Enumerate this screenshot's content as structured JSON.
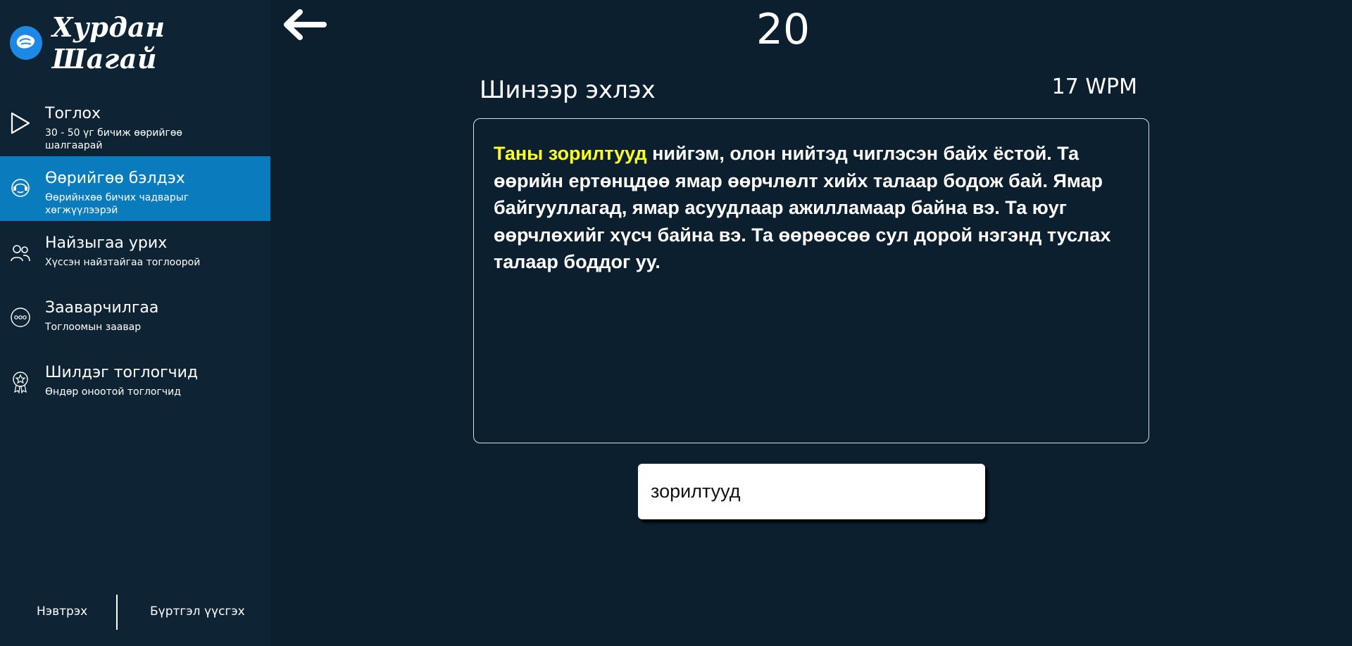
{
  "brand": {
    "name": "Хурдан Шагай",
    "logo_icon": "shagai-logo-icon"
  },
  "nav": {
    "items": [
      {
        "title": "Тоглох",
        "subtitle": "30 - 50 үг бичиж өөрийгөө шалгаарай",
        "icon": "play-icon",
        "active": false
      },
      {
        "title": "Өөрийгөө бэлдэх",
        "subtitle": "Өөрийнхөө бичих чадварыг хөгжүүлээрэй",
        "icon": "practice-icon",
        "active": true
      },
      {
        "title": "Найзыгаа урих",
        "subtitle": "Хүссэн найзтайгаа тоглоорой",
        "icon": "friends-icon",
        "active": false
      },
      {
        "title": "Зааварчилгаа",
        "subtitle": "Тоглоомын заавар",
        "icon": "instructions-icon",
        "active": false
      },
      {
        "title": "Шилдэг тоглогчид",
        "subtitle": "Өндөр оноотой тоглогчид",
        "icon": "award-icon",
        "active": false
      }
    ]
  },
  "auth": {
    "login": "Нэвтрэх",
    "register": "Бүртгэл үүсгэх"
  },
  "game": {
    "timer": "20",
    "restart_label": "Шинээр эхлэх",
    "wpm": "17 WPM",
    "passage": {
      "current_word": "Таны зорилтууд",
      "rest": " нийгэм, олон нийтэд чиглэсэн байх ёстой. Та өөрийн ертөнцдөө ямар өөрчлөлт хийх талаар бодож бай. Ямар байгууллагад, ямар асуудлаар ажилламаар байна вэ. Та юуг өөрчлөхийг хүсч байна вэ. Та өөрөөсөө сул дорой нэгэнд туслах талаар боддог уу."
    },
    "input_value": "зорилтууд"
  },
  "colors": {
    "background": "#0b1f2f",
    "sidebar": "#0e2434",
    "active": "#0a7bbd",
    "highlight": "#ffff1e"
  }
}
